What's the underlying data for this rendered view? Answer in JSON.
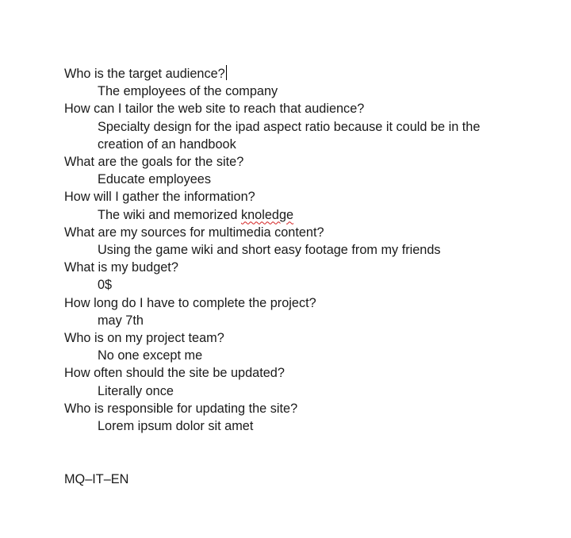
{
  "document": {
    "qa": [
      {
        "question": "Who is the target audience?",
        "answer": "The employees of the company"
      },
      {
        "question": "How can I tailor the web site to reach that audience?",
        "answer": "Specialty design for the ipad aspect ratio because it could be in the creation of an handbook"
      },
      {
        "question": "What are the goals for the site?",
        "answer": "Educate employees"
      },
      {
        "question": "How will I gather the information?",
        "answer_prefix": "The wiki and memorized ",
        "answer_misspelled": "knoledge"
      },
      {
        "question": "What are my sources for multimedia content?",
        "answer": "Using the game wiki and short easy footage from my friends"
      },
      {
        "question": "What is my budget?",
        "answer": "0$"
      },
      {
        "question": "How long do I have to complete the project?",
        "answer": "may 7th"
      },
      {
        "question": "Who is on my project team?",
        "answer": "No one except me"
      },
      {
        "question": "How often should the site be updated?",
        "answer": "Literally once"
      },
      {
        "question": "Who is responsible for updating the site?",
        "answer": "Lorem ipsum dolor sit amet"
      }
    ],
    "footer_code": "MQ–IT–EN"
  }
}
